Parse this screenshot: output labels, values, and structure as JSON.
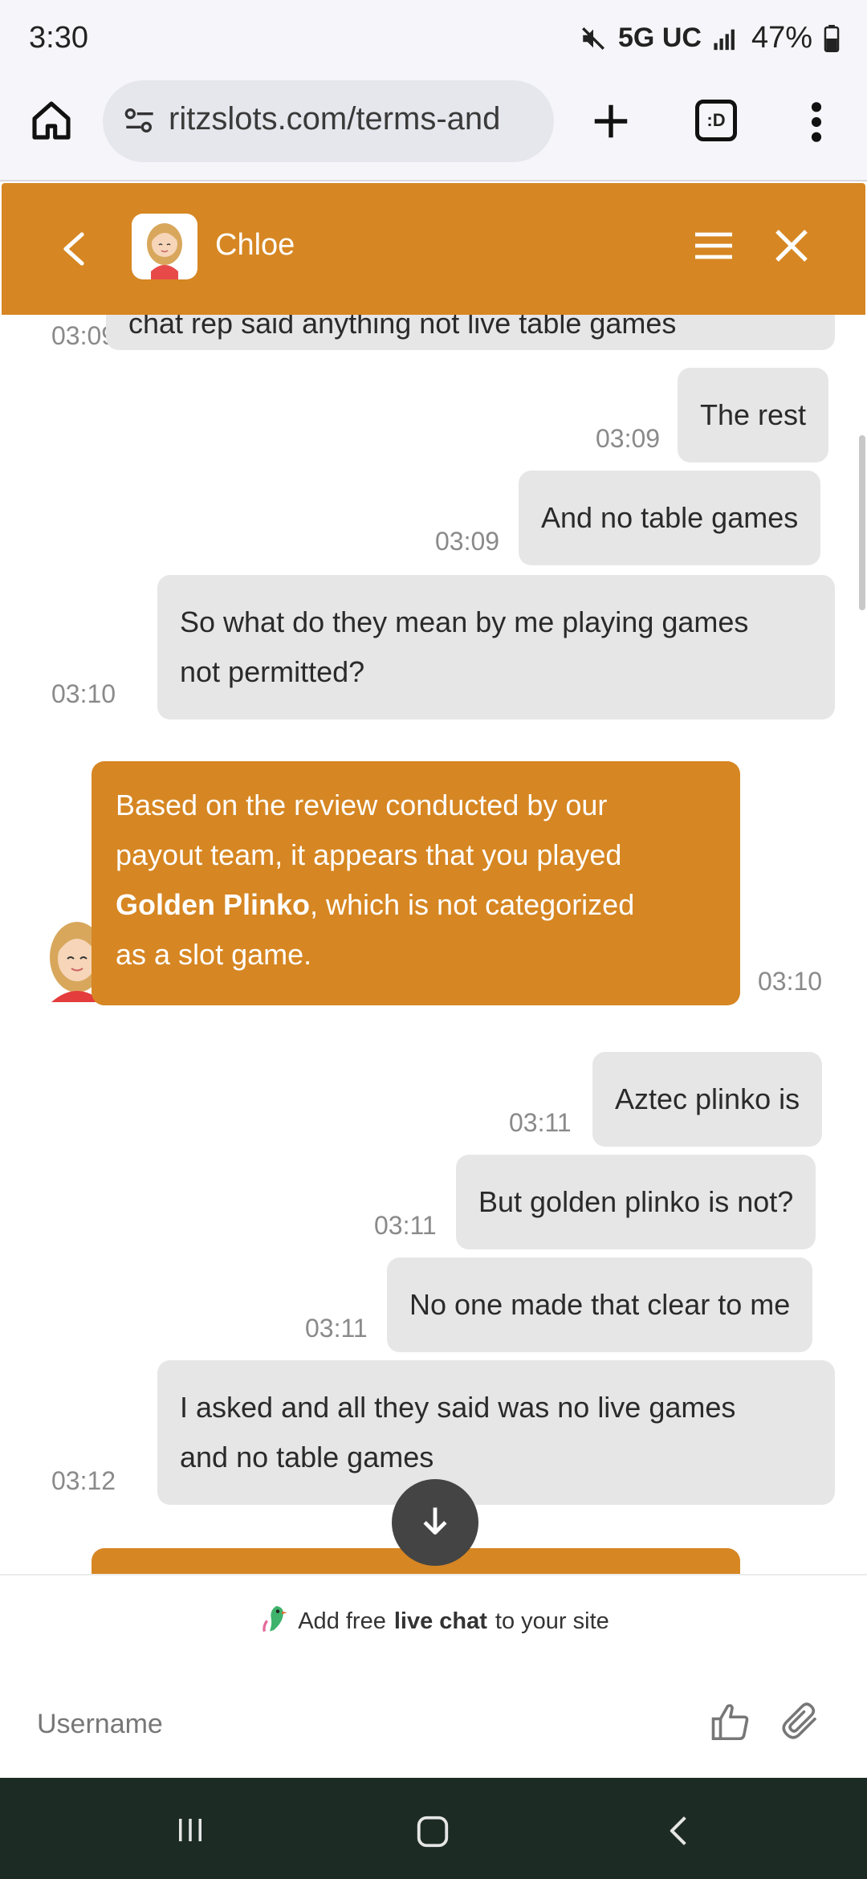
{
  "status_bar": {
    "time": "3:30",
    "network": "5G UC",
    "battery": "47%",
    "icons": [
      "mute-icon",
      "signal-icon",
      "battery-icon"
    ]
  },
  "browser": {
    "url": "ritzslots.com/terms-and",
    "tab_count_label": ":D",
    "icons": [
      "home-icon",
      "site-settings-icon",
      "plus-icon",
      "tabs-icon",
      "more-vert-icon"
    ]
  },
  "chat_header": {
    "agent_name": "Chloe",
    "accent_color": "#d68622",
    "icons": [
      "back-icon",
      "avatar",
      "hamburger-icon",
      "close-icon"
    ]
  },
  "messages": [
    {
      "from": "user",
      "text": "chat rep said anything not live table games",
      "time": "03:09"
    },
    {
      "from": "user",
      "text": "The rest",
      "time": "03:09"
    },
    {
      "from": "user",
      "text": "And no table games",
      "time": "03:09"
    },
    {
      "from": "user",
      "text_line1": "So what do they mean by me playing games",
      "text_line2": "not permitted?",
      "time": "03:10"
    },
    {
      "from": "agent",
      "line1": "Based on the review conducted by our",
      "line2": "payout team, it appears that you played",
      "bold": "Golden Plinko",
      "line3_rest": ", which is not categorized",
      "line4": "as a slot game.",
      "time": "03:10"
    },
    {
      "from": "user",
      "text": "Aztec plinko is",
      "time": "03:11"
    },
    {
      "from": "user",
      "text": "But golden plinko is not?",
      "time": "03:11"
    },
    {
      "from": "user",
      "text": "No one made that clear to me",
      "time": "03:11"
    },
    {
      "from": "user",
      "text_line1": "I asked and all they said was no live games",
      "text_line2": "and no table games",
      "time": "03:12"
    }
  ],
  "footer": {
    "powered_prefix": "Add free",
    "powered_bold": "live chat",
    "powered_suffix": "to your site",
    "input_placeholder": "Username",
    "icons": [
      "thumbs-up-icon",
      "paperclip-icon"
    ]
  },
  "nav": {
    "icons": [
      "recents-icon",
      "home-icon",
      "back-icon"
    ]
  }
}
